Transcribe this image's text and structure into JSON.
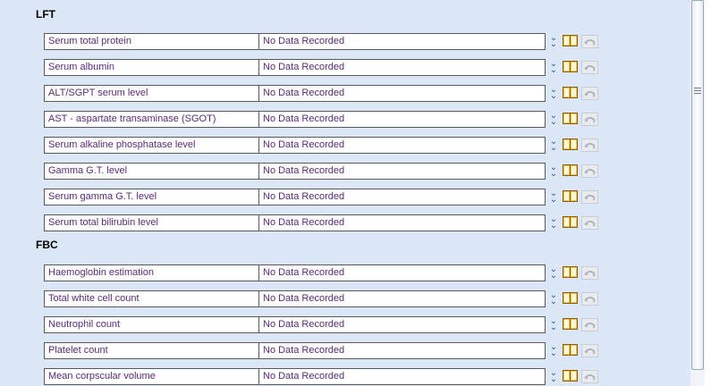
{
  "sections": [
    {
      "title": "LFT",
      "rows": [
        {
          "label": "Serum total protein",
          "value": "No Data Recorded"
        },
        {
          "label": "Serum albumin",
          "value": "No Data Recorded"
        },
        {
          "label": "ALT/SGPT serum level",
          "value": "No Data Recorded"
        },
        {
          "label": "AST - aspartate transaminase (SGOT)",
          "value": "No Data Recorded"
        },
        {
          "label": "Serum alkaline phosphatase level",
          "value": "No Data Recorded"
        },
        {
          "label": "Gamma G.T. level",
          "value": "No Data Recorded"
        },
        {
          "label": "Serum gamma G.T. level",
          "value": "No Data Recorded"
        },
        {
          "label": "Serum total bilirubin level",
          "value": "No Data Recorded"
        }
      ]
    },
    {
      "title": "FBC",
      "rows": [
        {
          "label": "Haemoglobin estimation",
          "value": "No Data Recorded"
        },
        {
          "label": "Total white cell count",
          "value": "No Data Recorded"
        },
        {
          "label": "Neutrophil count",
          "value": "No Data Recorded"
        },
        {
          "label": "Platelet count",
          "value": "No Data Recorded"
        },
        {
          "label": "Mean corpscular volume",
          "value": "No Data Recorded"
        }
      ]
    }
  ],
  "icons": {
    "expand": "chevron-down-double-icon",
    "book": "book-icon",
    "undo": "undo-arrow-icon"
  }
}
